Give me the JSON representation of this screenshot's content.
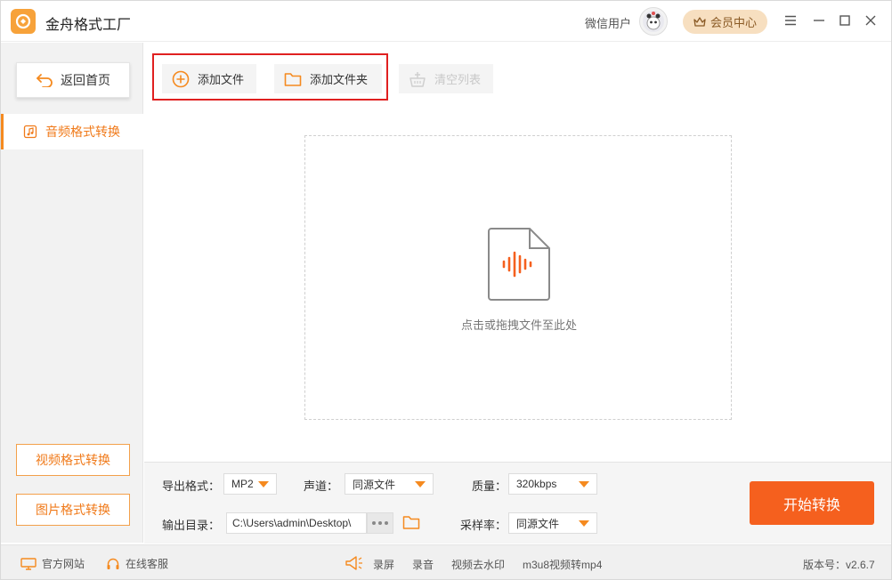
{
  "app": {
    "title": "金舟格式工厂",
    "user_name": "微信用户",
    "vip_label": "会员中心"
  },
  "colors": {
    "accent": "#f58a1f",
    "start_button": "#f5601e",
    "highlight_box": "#e02020",
    "vip_bg": "#f7dfc0"
  },
  "sidebar": {
    "back_label": "返回首页",
    "active_item": "音频格式转换",
    "video_btn": "视频格式转换",
    "image_btn": "图片格式转换"
  },
  "toolbar": {
    "add_file": "添加文件",
    "add_folder": "添加文件夹",
    "clear_list": "清空列表"
  },
  "dropzone": {
    "hint": "点击或拖拽文件至此处"
  },
  "settings": {
    "format_label": "导出格式：",
    "format_value": "MP2",
    "channel_label": "声道：",
    "channel_value": "同源文件",
    "quality_label": "质量：",
    "quality_value": "320kbps",
    "output_label": "输出目录：",
    "output_path": "C:\\Users\\admin\\Desktop\\",
    "samplerate_label": "采样率：",
    "samplerate_value": "同源文件",
    "start_label": "开始转换"
  },
  "statusbar": {
    "website": "官方网站",
    "service": "在线客服",
    "record_screen": "录屏",
    "record_audio": "录音",
    "watermark": "视频去水印",
    "m3u8": "m3u8视频转mp4",
    "version": "版本号：v2.6.7"
  }
}
